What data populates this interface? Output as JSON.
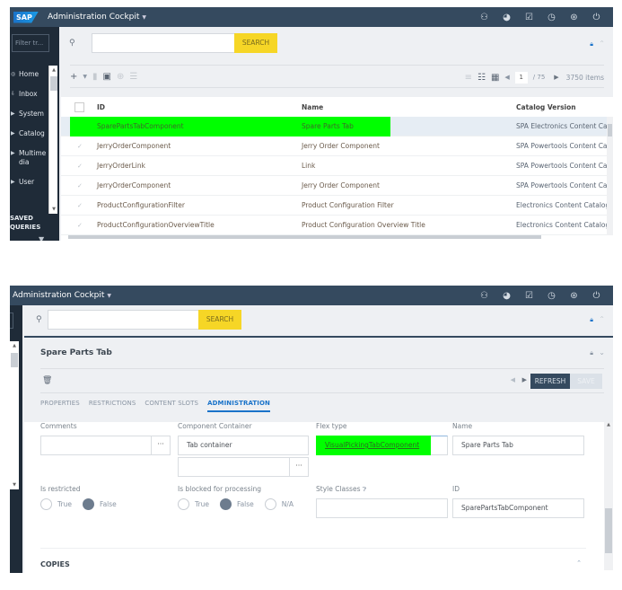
{
  "shell": {
    "logo": "SAP",
    "app_title": "Administration Cockpit",
    "icons": [
      "user-switch-icon",
      "compass-icon",
      "task-icon",
      "clock-icon",
      "global-search-icon",
      "power-icon"
    ]
  },
  "sidebar": {
    "filter_placeholder": "Filter tr...",
    "items": [
      {
        "label": "Home",
        "icon": "home-icon"
      },
      {
        "label": "Inbox",
        "icon": "inbox-icon"
      },
      {
        "label": "System",
        "icon": "caret-right-icon"
      },
      {
        "label": "Catalog",
        "icon": "caret-right-icon"
      },
      {
        "label": "Multimedia",
        "icon": "caret-right-icon"
      },
      {
        "label": "User",
        "icon": "caret-right-icon"
      }
    ],
    "saved_queries": "SAVED QUERIES"
  },
  "search": {
    "value": "",
    "button": "SEARCH"
  },
  "list_view": {
    "pagination": {
      "current_page": "1",
      "total_pages": "/ 75",
      "items_count": "3750 items"
    },
    "columns": [
      "ID",
      "Name",
      "Catalog Version"
    ],
    "rows": [
      {
        "id": "SparePartsTabComponent",
        "name": "Spare Parts Tab",
        "catalog": "SPA Electronics Content Catalog",
        "selected": true
      },
      {
        "id": "JerryOrderComponent",
        "name": "Jerry Order Component",
        "catalog": "SPA Powertools Content Catalog"
      },
      {
        "id": "JerryOrderLink",
        "name": "Link",
        "catalog": "SPA Powertools Content Catalog"
      },
      {
        "id": "JerryOrderComponent",
        "name": "Jerry Order Component",
        "catalog": "SPA Powertools Content Catalog"
      },
      {
        "id": "ProductConfigurationFilter",
        "name": "Product Configuration Filter",
        "catalog": "Electronics Content Catalog : Onl"
      },
      {
        "id": "ProductConfigurationOverviewTitle",
        "name": "Product Configuration Overview Title",
        "catalog": "Electronics Content Catalog : Onl"
      }
    ]
  },
  "editor": {
    "title": "Spare Parts Tab",
    "refresh": "REFRESH",
    "save": "SAVE",
    "tabs": [
      "PROPERTIES",
      "RESTRICTIONS",
      "CONTENT SLOTS",
      "ADMINISTRATION"
    ],
    "active_tab": "ADMINISTRATION",
    "fields": {
      "comments": {
        "label": "Comments",
        "value": ""
      },
      "component_container": {
        "label": "Component Container",
        "value": "Tab container",
        "second_value": ""
      },
      "flex_type": {
        "label": "Flex type",
        "value": "VisualPickingTabComponent"
      },
      "name": {
        "label": "Name",
        "value": "Spare Parts Tab"
      },
      "is_restricted": {
        "label": "Is restricted",
        "options": [
          "True",
          "False"
        ],
        "selected": "False"
      },
      "is_blocked": {
        "label": "Is blocked for processing",
        "options": [
          "True",
          "False",
          "N/A"
        ],
        "selected": "False"
      },
      "style_classes": {
        "label": "Style Classes",
        "value": ""
      },
      "id": {
        "label": "ID",
        "value": "SparePartsTabComponent"
      }
    },
    "copies_section": "COPIES"
  },
  "highlight_color": "#00ff00",
  "shell_color": "#354a5f",
  "search_button_color": "#f6d626"
}
